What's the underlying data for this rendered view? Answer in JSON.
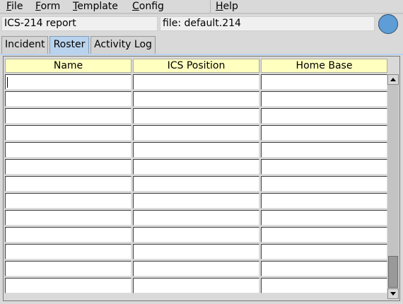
{
  "menu": {
    "items": [
      {
        "label": "File"
      },
      {
        "label": "Form"
      },
      {
        "label": "Template"
      },
      {
        "label": "Config"
      },
      {
        "label": "Help"
      }
    ]
  },
  "header": {
    "report_title": "ICS-214 report",
    "file_label": "file: default.214",
    "status_color": "#5f9dd6"
  },
  "tabs": [
    {
      "label": "Incident",
      "active": false
    },
    {
      "label": "Roster",
      "active": true
    },
    {
      "label": "Activity Log",
      "active": false
    }
  ],
  "table": {
    "columns": [
      "Name",
      "ICS Position",
      "Home Base"
    ],
    "rows": [
      [
        "",
        "",
        ""
      ],
      [
        "",
        "",
        ""
      ],
      [
        "",
        "",
        ""
      ],
      [
        "",
        "",
        ""
      ],
      [
        "",
        "",
        ""
      ],
      [
        "",
        "",
        ""
      ],
      [
        "",
        "",
        ""
      ],
      [
        "",
        "",
        ""
      ],
      [
        "",
        "",
        ""
      ],
      [
        "",
        "",
        ""
      ],
      [
        "",
        "",
        ""
      ],
      [
        "",
        "",
        ""
      ],
      [
        "",
        "",
        ""
      ]
    ]
  },
  "colors": {
    "header_bg": "#ffffc0",
    "active_tab_bg": "#b9d3ee",
    "window_bg": "#d9d9d9"
  }
}
